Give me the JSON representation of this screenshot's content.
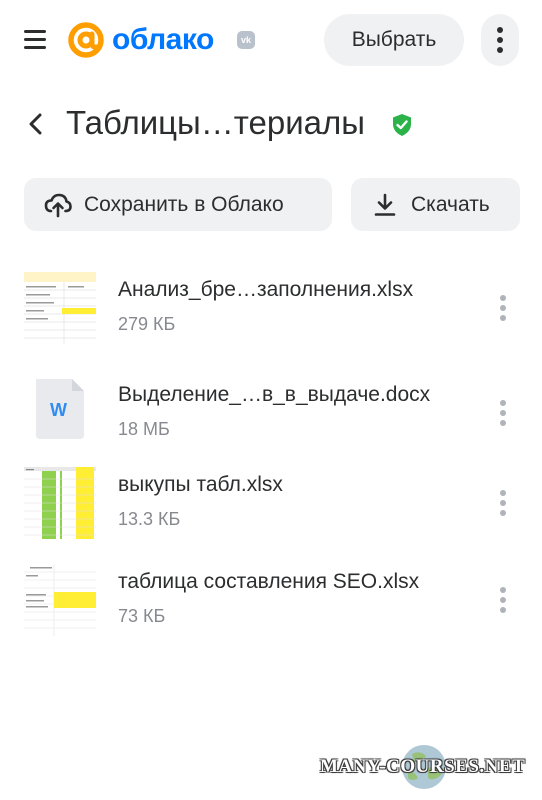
{
  "header": {
    "logo_text": "облако",
    "vk_badge": "vk",
    "select_label": "Выбрать"
  },
  "folder": {
    "title": "Таблицы…териалы",
    "verified": true
  },
  "actions": {
    "save_label": "Сохранить в Облако",
    "download_label": "Скачать"
  },
  "files": [
    {
      "name": "Анализ_бре…заполнения.xlsx",
      "size": "279 КБ",
      "type": "xlsx"
    },
    {
      "name": "Выделение_…в_в_выдаче.docx",
      "size": "18 МБ",
      "type": "docx",
      "icon_letter": "W"
    },
    {
      "name": "выкупы табл.xlsx",
      "size": "13.3 КБ",
      "type": "xlsx"
    },
    {
      "name": "таблица составления SEO.xlsx",
      "size": "73 КБ",
      "type": "xlsx"
    }
  ],
  "watermark": {
    "text": "MANY-COURSES.NET"
  },
  "colors": {
    "accent": "#0077ff",
    "logo_orange": "#ff9e00",
    "verified_green": "#2bb34a",
    "button_bg": "#f0f1f3",
    "secondary_text": "#87898f"
  }
}
